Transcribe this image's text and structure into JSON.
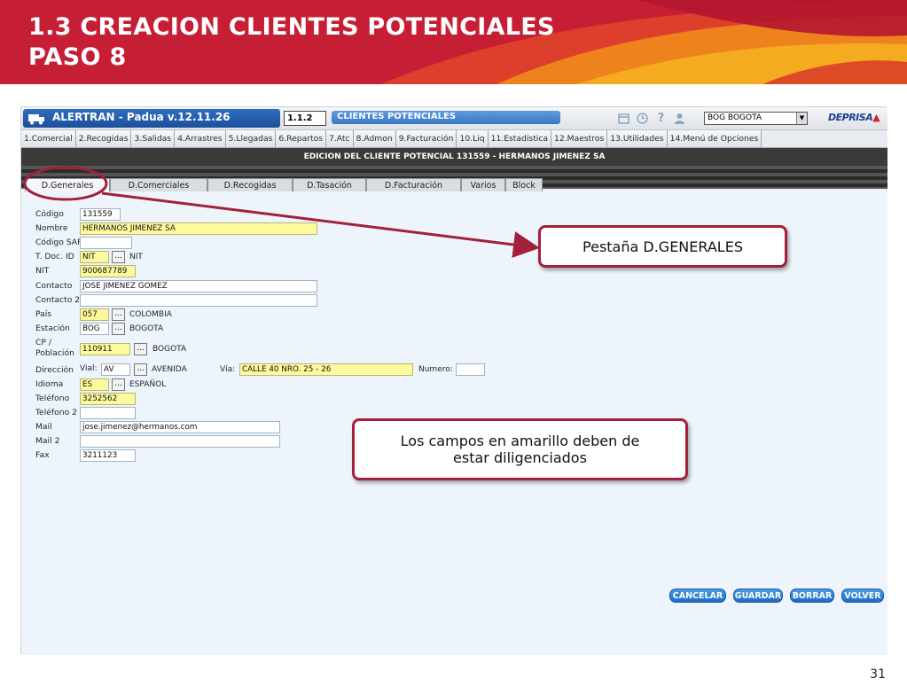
{
  "slide": {
    "title_line1": "1.3 CREACION CLIENTES POTENCIALES",
    "title_line2": "PASO 8",
    "page_number": "31"
  },
  "app": {
    "name": "ALERTRAN - Padua  v.12.11.26",
    "module_code": "1.1.2",
    "module_name": "CLIENTES POTENCIALES",
    "office": "BOG BOGOTA",
    "brand": "DEPRISA",
    "help_icon": "?"
  },
  "menu": [
    "1.Comercial",
    "2.Recogidas",
    "3.Salidas",
    "4.Arrastres",
    "5.Llegadas",
    "6.Repartos",
    "7.Atc",
    "8.Admon",
    "9.Facturación",
    "10.Liq",
    "11.Estadística",
    "12.Maestros",
    "13.Utilidades",
    "14.Menú de Opciones"
  ],
  "edit_title": "EDICION DEL CLIENTE POTENCIAL 131559 - HERMANOS JIMENEZ SA",
  "tabs": [
    "D.Generales",
    "D.Comerciales",
    "D.Recogidas",
    "D.Tasación",
    "D.Facturación",
    "Varios",
    "Block"
  ],
  "form": {
    "codigo": {
      "label": "Código",
      "value": "131559"
    },
    "nombre": {
      "label": "Nombre",
      "value": "HERMANOS JIMENEZ SA"
    },
    "codigo_sap": {
      "label": "Código SAP",
      "value": ""
    },
    "tdoc": {
      "label": "T. Doc. ID",
      "value": "NIT",
      "desc": "NIT"
    },
    "nit": {
      "label": "NIT",
      "value": "900687789"
    },
    "contacto": {
      "label": "Contacto",
      "value": "JOSE JIMENEZ GOMEZ"
    },
    "contacto2": {
      "label": "Contacto 2",
      "value": ""
    },
    "pais": {
      "label": "País",
      "value": "057",
      "desc": "COLOMBIA"
    },
    "estacion": {
      "label": "Estación",
      "value": "BOG",
      "desc": "BOGOTA"
    },
    "cp": {
      "label_line1": "CP /",
      "label_line2": "Población",
      "value": "110911",
      "desc": "BOGOTA"
    },
    "direccion": {
      "label": "Dirección",
      "vial_label": "Vial:",
      "vial_value": "AV",
      "vial_desc": "AVENIDA",
      "via_label": "Vía:",
      "via_value": "CALLE 40 NRO. 25 - 26",
      "numero_label": "Numero:",
      "numero_value": ""
    },
    "idioma": {
      "label": "Idioma",
      "value": "ES",
      "desc": "ESPAÑOL"
    },
    "telefono": {
      "label": "Teléfono",
      "value": "3252562"
    },
    "telefono2": {
      "label": "Teléfono 2",
      "value": ""
    },
    "mail": {
      "label": "Mail",
      "value": "jose.jimenez@hermanos.com"
    },
    "mail2": {
      "label": "Mail 2",
      "value": ""
    },
    "fax": {
      "label": "Fax",
      "value": "3211123"
    },
    "dots": "..."
  },
  "buttons": {
    "cancel": "CANCELAR",
    "save": "GUARDAR",
    "delete": "BORRAR",
    "back": "VOLVER"
  },
  "callouts": {
    "tab_note": "Pestaña D.GENERALES",
    "yellow_note_line1": "Los campos en amarillo deben de",
    "yellow_note_line2": "estar diligenciados"
  },
  "colors": {
    "banner": "#c61f35",
    "callout_border": "#a3203b",
    "required_field": "#fdfa9d",
    "button_blue": "#1f6bc3"
  }
}
